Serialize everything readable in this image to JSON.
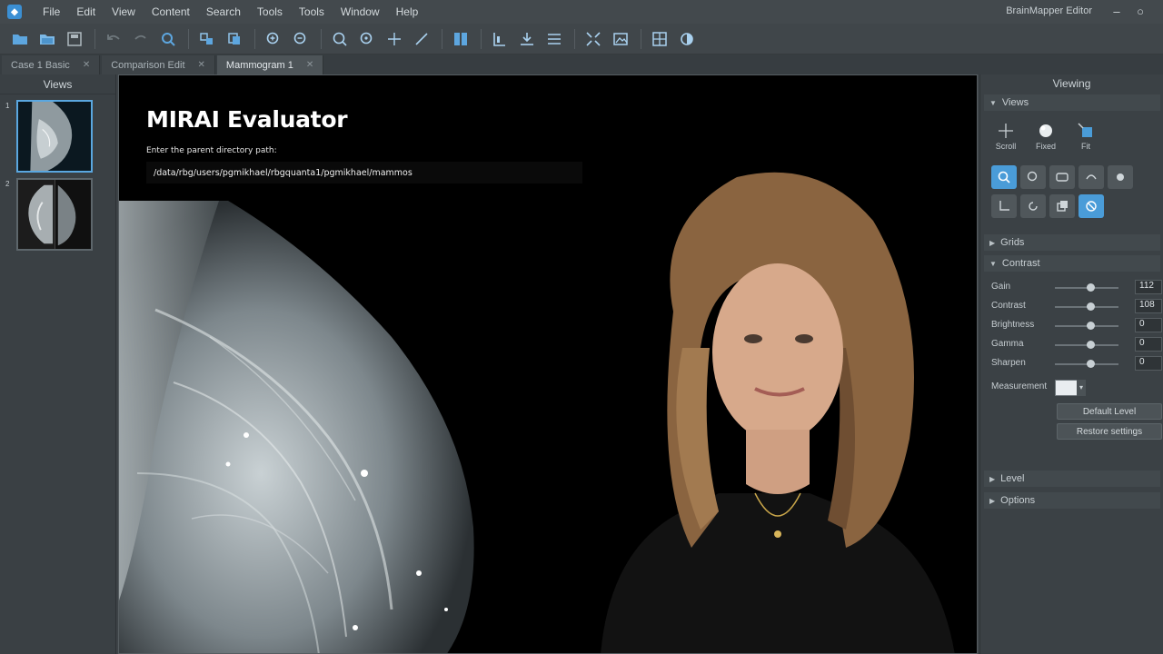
{
  "menu": {
    "items": [
      "File",
      "Edit",
      "View",
      "Content",
      "Search",
      "Tools",
      "Tools",
      "Window",
      "Help"
    ],
    "window_title": "BrainMapper Editor"
  },
  "tabs": [
    {
      "label": "Case 1 Basic"
    },
    {
      "label": "Comparison Edit"
    },
    {
      "label": "Mammogram 1"
    }
  ],
  "left_panel": {
    "title": "Views",
    "thumbs": [
      {
        "index": "1"
      },
      {
        "index": "2"
      }
    ]
  },
  "viewport": {
    "title": "MIRAI Evaluator",
    "path_label": "Enter the parent directory path:",
    "path_value": "/data/rbg/users/pgmikhael/rbgquanta1/pgmikhael/mammos"
  },
  "right_panel": {
    "title": "Viewing",
    "sections": {
      "views": "Views",
      "grids": "Grids",
      "contrast": "Contrast",
      "extra": "Level",
      "options": "Options"
    },
    "big_tools": [
      {
        "label": "Scroll",
        "icon": "crosshair-icon"
      },
      {
        "label": "Fixed",
        "icon": "sphere-icon"
      },
      {
        "label": "Fit",
        "icon": "fit-icon"
      }
    ],
    "sliders": [
      {
        "label": "Gain",
        "value": "112",
        "level": 0.55
      },
      {
        "label": "Contrast",
        "value": "108",
        "level": 0.55
      },
      {
        "label": "Brightness",
        "value": "0",
        "level": 0.55
      },
      {
        "label": "Gamma",
        "value": "0",
        "level": 0.55
      },
      {
        "label": "Sharpen",
        "value": "0",
        "level": 0.55
      }
    ],
    "measurement_label": "Measurement",
    "buttons": {
      "reset": "Default Level",
      "apply": "Restore settings"
    }
  },
  "colors": {
    "accent": "#4a9cd8",
    "chrome": "#3d4347",
    "viewport_bg": "#000000"
  }
}
